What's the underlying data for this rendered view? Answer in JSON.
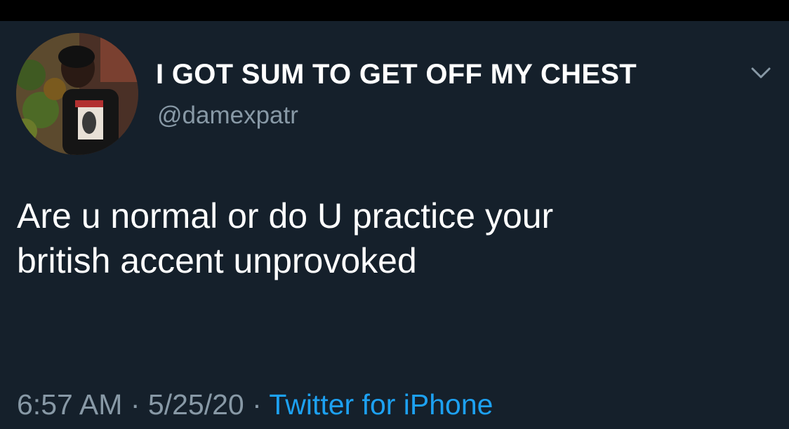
{
  "tweet": {
    "display_name": "I GOT SUM TO GET OFF MY CHEST",
    "handle": "@damexpatr",
    "text_lines": [
      "Are u normal or do U practice your",
      "british accent unprovoked"
    ],
    "time": "6:57 AM",
    "separator": "·",
    "date": "5/25/20",
    "source": "Twitter for iPhone"
  },
  "icons": {
    "menu": "chevron-down-icon",
    "avatar": "profile-photo"
  },
  "colors": {
    "background": "#15202b",
    "text_primary": "#ffffff",
    "text_secondary": "#8899a6",
    "link": "#1da1f2"
  }
}
